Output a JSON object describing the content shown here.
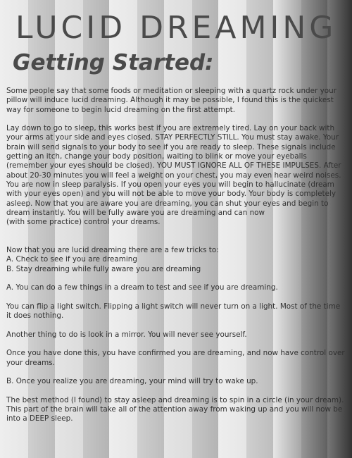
{
  "title": "LUCID DREAMING",
  "subtitle": "Getting Started:",
  "paragraphs": [
    [
      "Some people say that some foods or meditation or sleeping with a quartz rock under your pillow will induce lucid dreaming. Although it may be possible, I found this is the quickest way for someone to begin lucid dreaming on the first attempt."
    ],
    [
      "Lay down to go to sleep, this works best if you are extremely tired. Lay on your back with your arms at your side and eyes closed. STAY PERFECTLY STILL. You must stay awake. Your brain will send signals to your body to see if you are ready to sleep. These signals include getting an itch, change your body position, waiting to blink or move your eyeballs (remember your eyes should be closed). YOU MUST IGNORE ALL OF THESE IMPULSES. After about 20-30 minutes you will feel a weight on your chest, you may even hear weird noises. You are now in sleep paralysis. If you open your eyes you will begin to hallucinate (dream with your eyes open) and you will not be able to move your body. Your body is completely asleep. Now that you are aware you are dreaming, you can shut your eyes and begin to dream instantly. You will be fully aware you are dreaming and can now",
      "(with some practice) control your dreams."
    ],
    [
      "Now that you are lucid dreaming there are a few tricks to:",
      "A.  Check to see if you are dreaming",
      "B.  Stay dreaming while fully aware you are dreaming"
    ],
    [
      "A.  You can do a few things in a dream to test and see if you are dreaming."
    ],
    [
      "You can flip a light switch. Flipping a light switch will never turn on a light. Most of the time it does nothing."
    ],
    [
      "Another thing to do is look in a mirror. You will never see yourself."
    ],
    [
      "Once you have done this, you have confirmed you are dreaming, and now have control over your dreams."
    ],
    [
      "B.  Once you realize you are dreaming, your mind will try to wake up."
    ],
    [
      "The best method (I found) to stay asleep and dreaming is to spin in a circle (in your dream). This part of the brain will take all of the attention away from waking up and you will now be into a DEEP sleep."
    ]
  ]
}
